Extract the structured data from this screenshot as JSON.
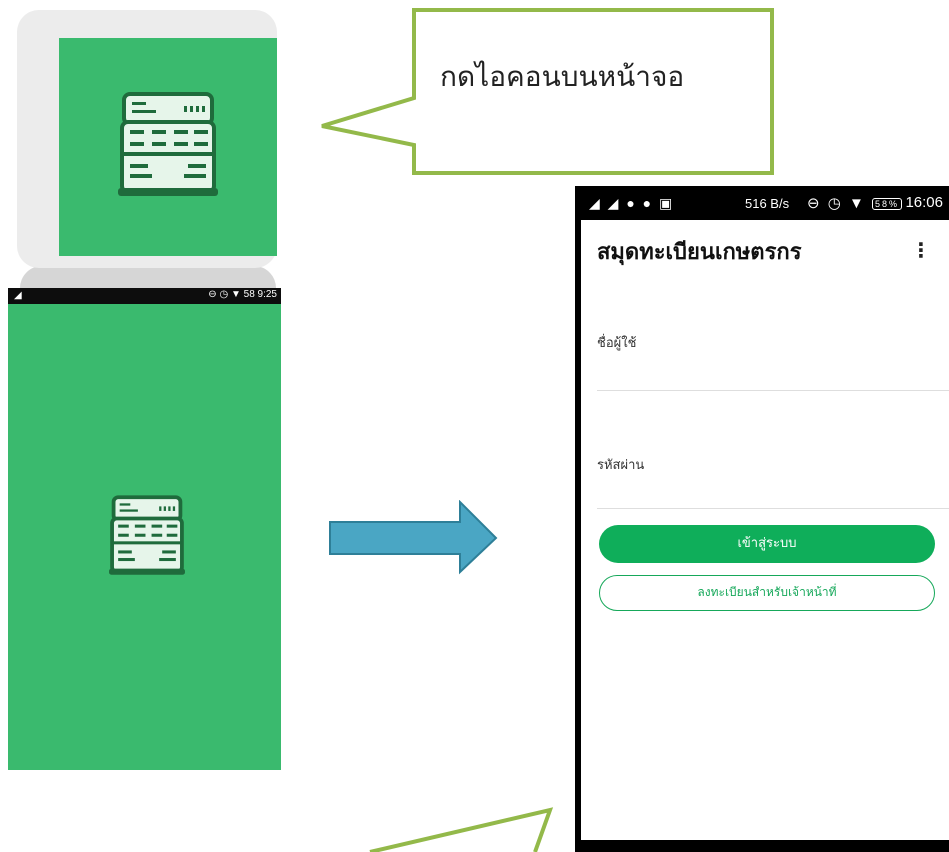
{
  "callout": {
    "text": "กดไอคอนบนหน้าจอ"
  },
  "splash_status": {
    "signal": "◢",
    "right": "⊖ ◷ ▼ 58 9:25"
  },
  "phone_status": {
    "left_icons": "◢ ◢ ● ● ▣",
    "speed": "516 B/s",
    "right_icons": "⊖ ◷ ▼",
    "battery": "58%",
    "time": "16:06"
  },
  "app": {
    "title": "สมุดทะเบียนเกษตรกร",
    "menu_icon": "⋮",
    "username_label": "ชื่อผู้ใช้",
    "password_label": "รหัสผ่าน",
    "login_button": "เข้าสู่ระบบ",
    "register_button": "ลงทะเบียนสำหรับเจ้าหน้าที่"
  },
  "colors": {
    "brand_green": "#3aba6e",
    "button_green": "#0fae5a",
    "callout_border": "#93b94a",
    "arrow_fill": "#4aa6c4"
  }
}
